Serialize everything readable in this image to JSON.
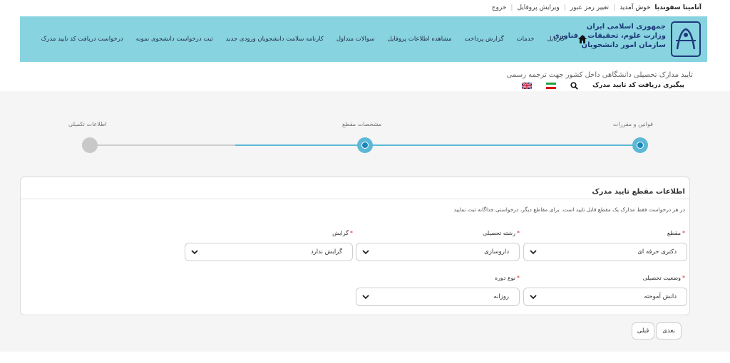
{
  "topbar": {
    "user_name": "آنامیتا سفوندیا",
    "welcome": "خوش آمدید",
    "links": [
      "تغییر رمز عبور",
      "ویرایش پروفایل",
      "خروج"
    ]
  },
  "header": {
    "org_lines": [
      "جمهوری اسلامی ایران",
      "وزارت علوم، تحقیقات و فناوری",
      "سازمان امور دانشجویان"
    ],
    "nav": [
      "کارتابل",
      "خدمات",
      "گزارش پرداخت",
      "مشاهده اطلاعات پروفایل",
      "سوالات متداول",
      "کارنامه سلامت دانشجویان ورودی جدید",
      "ثبت درخواست دانشجوی نمونه",
      "درخواست دریافت کد تایید مدرک"
    ],
    "bg_color": "#88d3e0"
  },
  "page": {
    "title": "تایید مدارک تحصیلی دانشگاهی داخل کشور جهت ترجمه رسمی",
    "track_link": "پیگیری دریافت کد تایید مدرک"
  },
  "stepper": {
    "steps": [
      {
        "label": "قوانین و مقررات",
        "state": "done"
      },
      {
        "label": "مشخصات مقطع",
        "state": "current"
      },
      {
        "label": "اطلاعات تکمیلی",
        "state": "pending"
      }
    ],
    "active_color": "#5bb8d6",
    "inactive_color": "#cccccc"
  },
  "form": {
    "title": "اطلاعات مقطع تایید مدرک",
    "note": "در هر درخواست فقط مدارک یک مقطع قابل تایید است. برای مقاطع دیگر، درخواستی جداگانه ثبت نمایید",
    "fields": {
      "degree": {
        "label": "مقطع",
        "value": "دکتری حرفه ای"
      },
      "major": {
        "label": "رشته تحصیلی",
        "value": "داروسازی"
      },
      "orientation": {
        "label": "گرایش",
        "value": "گرایش ندارد"
      },
      "status": {
        "label": "وضعیت تحصیلی",
        "value": "دانش آموخته"
      },
      "course_type": {
        "label": "نوع دوره",
        "value": "روزانه"
      }
    }
  },
  "buttons": {
    "next": "بعدی",
    "prev": "قبلی"
  }
}
